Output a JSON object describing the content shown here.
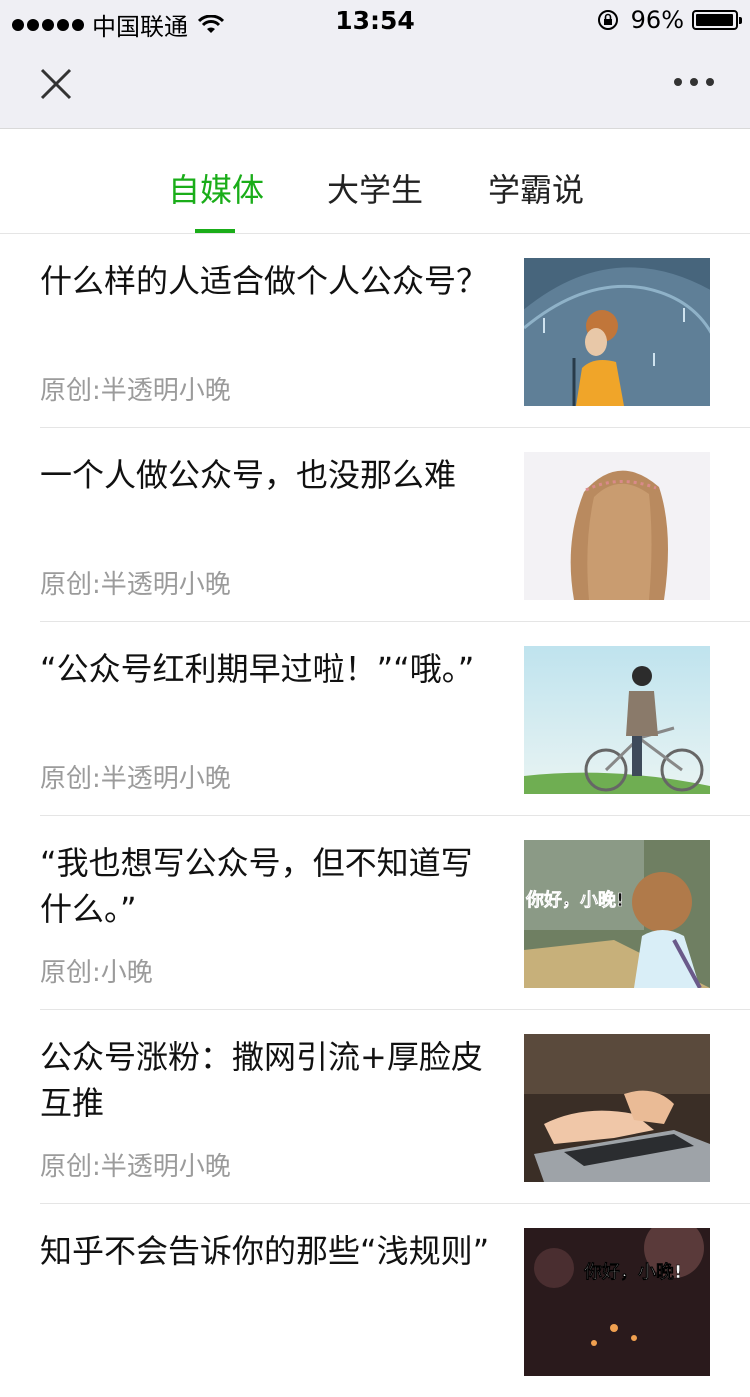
{
  "status_bar": {
    "carrier": "中国联通",
    "time": "13:54",
    "battery_percent": "96%"
  },
  "nav": {
    "close_icon": "close-icon",
    "more_icon": "more-icon"
  },
  "tabs": [
    {
      "label": "自媒体",
      "active": true
    },
    {
      "label": "大学生",
      "active": false
    },
    {
      "label": "学霸说",
      "active": false
    }
  ],
  "colors": {
    "accent": "#1aad19",
    "source_text": "#9b9b9b"
  },
  "articles": [
    {
      "title": "什么样的人适合做个人公众号？",
      "source": "原创:半透明小晚"
    },
    {
      "title": "一个人做公众号，也没那么难",
      "source": "原创:半透明小晚"
    },
    {
      "title": "“公众号红利期早过啦！”“哦。”",
      "source": "原创:半透明小晚"
    },
    {
      "title": "“我也想写公众号，但不知道写什么。”",
      "source": "原创:小晚"
    },
    {
      "title": "公众号涨粉：撒网引流+厚脸皮互推",
      "source": "原创:半透明小晚"
    },
    {
      "title": "知乎不会告诉你的那些“浅规则”",
      "source": ""
    }
  ],
  "thumb_captions": {
    "item4": "你好，小晚!",
    "item6": "你好，小晚!"
  }
}
